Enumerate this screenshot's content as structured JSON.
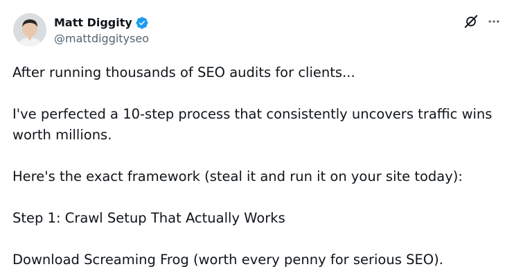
{
  "author": {
    "name": "Matt Diggity",
    "handle": "@mattdiggityseo",
    "verified_color": "#1d9bf0"
  },
  "actions": {
    "grok_icon": "grok-icon",
    "more_icon": "more-options-icon"
  },
  "post": {
    "paragraphs": [
      "After running thousands of SEO audits for clients...",
      "I've perfected a 10-step process that consistently uncovers traffic wins worth millions.",
      "Here's the exact framework (steal it and run it on your site today):",
      "Step 1: Crawl Setup That Actually Works",
      "Download Screaming Frog (worth every penny for serious SEO)."
    ]
  }
}
